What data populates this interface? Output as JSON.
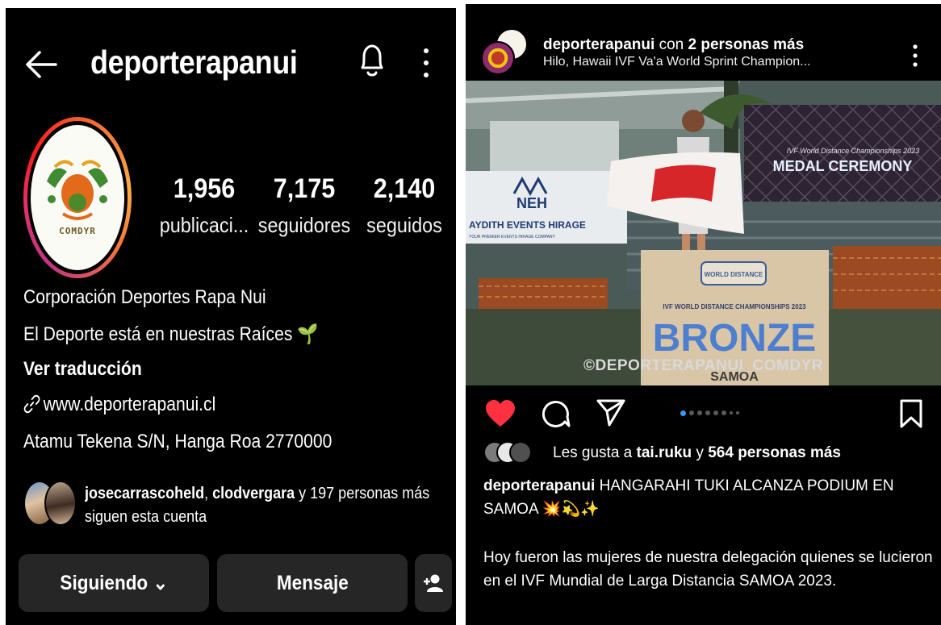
{
  "profile": {
    "username": "deporterapanui",
    "avatar_text": "COMDYR",
    "stats": [
      {
        "value": "1,956",
        "label": "publicaci..."
      },
      {
        "value": "7,175",
        "label": "seguidores"
      },
      {
        "value": "2,140",
        "label": "seguidos"
      }
    ],
    "bio": {
      "name": "Corporación Deportes Rapa Nui",
      "tagline": "El Deporte está en nuestras Raíces 🌱",
      "translate": "Ver traducción",
      "link": "www.deporterapanui.cl",
      "address": "Atamu Tekena S/N, Hanga Roa 2770000"
    },
    "mutual": {
      "user1": "josecarrascoheld",
      "sep": ", ",
      "user2": "clodvergara",
      "rest": " y 197 personas más",
      "line2": "siguen esta cuenta"
    },
    "buttons": {
      "following": "Siguiendo ⌄",
      "message": "Mensaje"
    }
  },
  "post": {
    "author": "deporterapanui",
    "coauthors": " con ",
    "coauthors_count": "2 personas más",
    "location": "Hilo, Hawaii IVF Va'a World Sprint Champion...",
    "photo": {
      "banner_title": "IVF World Distance Championships 2023",
      "banner_big": "MEDAL CEREMONY",
      "sponsor_logo": "NEH",
      "sponsor_name": "AYDITH EVENTS HIRAGE",
      "sponsor_sub": "YOUR PREMIER EVENTS HIRAGE COMPANY",
      "podium_logo": "WORLD DISTANCE",
      "podium_title": "IVF WORLD DISTANCE CHAMPIONSHIPS 2023",
      "podium_medal": "BRONZE",
      "podium_bottom": "SAMOA",
      "watermark": "©DEPORTERAPANUI_COMDYR"
    },
    "likes": {
      "prefix": "Les gusta a ",
      "user": "tai.ruku",
      "middle": " y ",
      "count": "564 personas más"
    },
    "caption_author": "deporterapanui",
    "caption_title": " HANGARAHI TUKI ALCANZA PODIUM EN SAMOA 💥💫✨",
    "caption_body": "Hoy fueron las mujeres de nuestra delegación quienes se lucieron en el IVF Mundial de Larga Distancia SAMOA 2023."
  },
  "colors": {
    "background": "#000000",
    "like": "#ff3040",
    "carousel_active": "#3897f0",
    "button_bg": "#262626"
  },
  "icons": [
    "back-arrow-icon",
    "bell-icon",
    "more-vertical-icon",
    "link-icon",
    "add-user-icon",
    "heart-icon",
    "comment-icon",
    "share-icon",
    "bookmark-icon"
  ]
}
